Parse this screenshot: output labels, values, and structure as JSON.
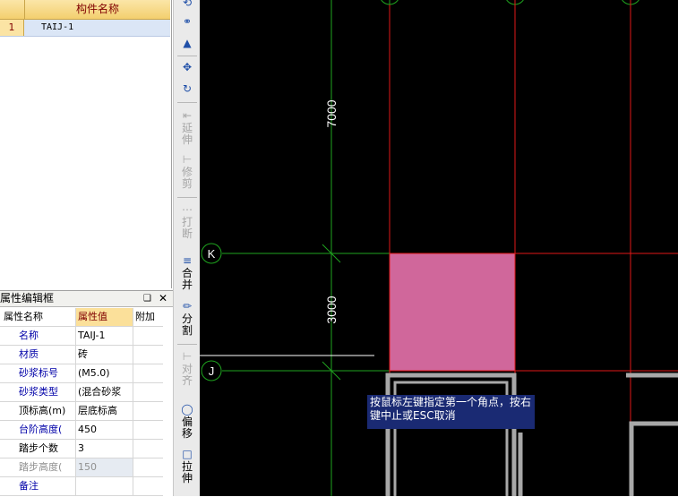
{
  "component_list": {
    "header": "构件名称",
    "rows": [
      {
        "index": "1",
        "name": "TAIJ-1"
      }
    ]
  },
  "property_panel": {
    "title": "属性编辑框",
    "pin_label": "❑",
    "close_label": "✕",
    "columns": {
      "name": "属性名称",
      "value": "属性值",
      "extra": "附加"
    },
    "rows": [
      {
        "name": "名称",
        "value": "TAIJ-1"
      },
      {
        "name": "材质",
        "value": "砖"
      },
      {
        "name": "砂浆标号",
        "value": "(M5.0)"
      },
      {
        "name": "砂浆类型",
        "value": "(混合砂浆"
      },
      {
        "name": "顶标高(m)",
        "value": "层底标高"
      },
      {
        "name": "台阶高度(",
        "value": "450"
      },
      {
        "name": "踏步个数",
        "value": "3"
      },
      {
        "name": "踏步高度(",
        "value": "150"
      },
      {
        "name": "备注",
        "value": ""
      }
    ]
  },
  "toolbar": {
    "extend": "延伸",
    "trim": "修剪",
    "break": "打断",
    "merge": "合并",
    "split": "分割",
    "align": "对齐",
    "offset": "偏移",
    "stretch": "拉伸"
  },
  "canvas": {
    "dim_upper": "7000",
    "dim_lower": "3000",
    "axis_k": "K",
    "axis_j": "J",
    "tooltip_line1": "按鼠标左键指定第一个角点，按右",
    "tooltip_line2": "键中止或ESC取消",
    "colors": {
      "background": "#000000",
      "axis_green": "#1fa51f",
      "axis_red": "#e01818",
      "selection_fill": "#d0679b",
      "wall_gray": "#a8a8a8"
    }
  }
}
